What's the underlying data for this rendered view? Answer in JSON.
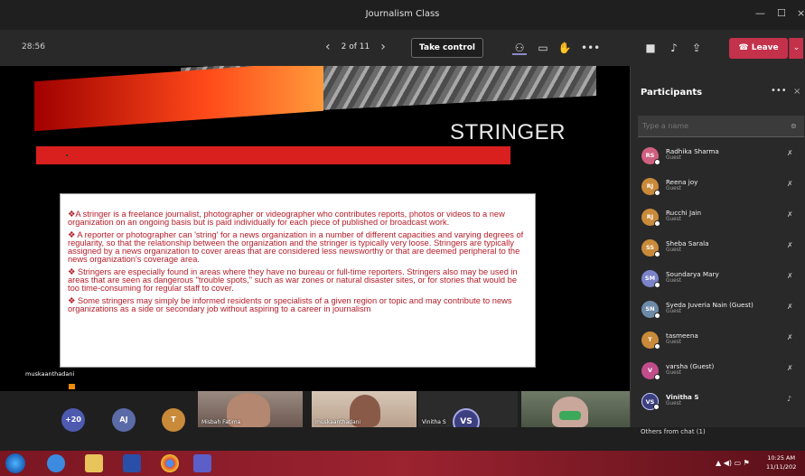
{
  "window": {
    "title": "Journalism Class"
  },
  "toolbar": {
    "timer": "28:56",
    "page_indicator": "2 of 11",
    "take_control_label": "Take control",
    "leave_label": "Leave"
  },
  "slide": {
    "title": "STRINGER",
    "bullets": [
      "A stringer is a freelance journalist, photographer or videographer who contributes reports, photos or videos to a new organization on an ongoing basis but is paid individually for each piece of published or broadcast work.",
      " A reporter or photographer can 'string' for a news organization in a number of different capacities and varying degrees of regularity, so that the relationship between the organization and the stringer is typically very loose. Stringers are typically assigned by a news organization to cover areas that are considered less newsworthy or that are deemed peripheral to the news organization's coverage area.",
      "  Stringers are especially found in areas where they have no bureau or full-time reporters. Stringers also may be used in areas that are seen as dangerous \"trouble spots,\" such as war zones or natural disaster sites, or for stories that would be too time-consuming for regular staff to cover.",
      " Some stringers may simply be informed residents or specialists of a given region or topic and may contribute to news organizations as a side or secondary job without aspiring to a career in journalism"
    ],
    "presenter_name": "muskaanthadani"
  },
  "participants": {
    "title": "Participants",
    "search_placeholder": "Type a name",
    "list": [
      {
        "initials": "RS",
        "name": "Radhika Sharma",
        "role": "Guest",
        "color": "#d0607f"
      },
      {
        "initials": "RJ",
        "name": "Reena joy",
        "role": "Guest",
        "color": "#c98a3a"
      },
      {
        "initials": "RJ",
        "name": "Rucchi Jain",
        "role": "Guest",
        "color": "#c98a3a"
      },
      {
        "initials": "SS",
        "name": "Sheba Sarala",
        "role": "Guest",
        "color": "#c98a3a"
      },
      {
        "initials": "SM",
        "name": "Soundarya Mary",
        "role": "Guest",
        "color": "#7b83c9"
      },
      {
        "initials": "SN",
        "name": "Syeda Juveria Nain (Guest)",
        "role": "Guest",
        "color": "#6d8aa8"
      },
      {
        "initials": "T",
        "name": "tasmeena",
        "role": "Guest",
        "color": "#c98a3a"
      },
      {
        "initials": "V",
        "name": "varsha (Guest)",
        "role": "Guest",
        "color": "#c14d8a"
      },
      {
        "initials": "VS",
        "name": "Vinitha S",
        "role": "Guest",
        "color": "#3c3f80"
      }
    ],
    "others_label": "Others from chat (1)"
  },
  "gallery": {
    "more_count": "+20",
    "avatars": [
      {
        "initials": "AJ",
        "color": "#5b6ba8"
      },
      {
        "initials": "T",
        "color": "#c98a3a"
      }
    ],
    "tiles": [
      {
        "label": "Misbah Fatima"
      },
      {
        "label": "muskaanthadani"
      },
      {
        "label": "Vinitha S",
        "initials": "VS"
      },
      {
        "label": ""
      }
    ]
  },
  "taskbar": {
    "time": "10:25 AM",
    "date": "11/11/202"
  }
}
